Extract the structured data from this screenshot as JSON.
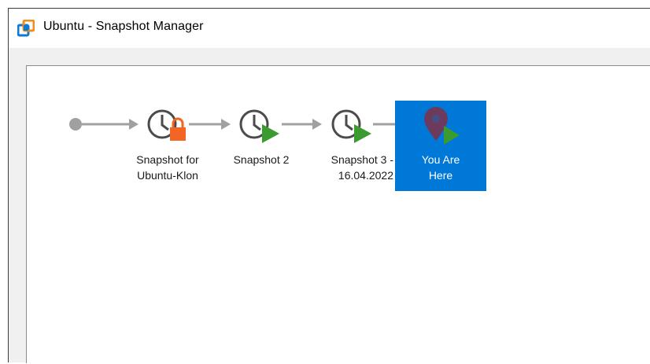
{
  "window": {
    "title": "Ubuntu - Snapshot Manager",
    "app_icon": "vmware-icon"
  },
  "snapshots": [
    {
      "label": "Snapshot for\nUbuntu-Klon",
      "icon": "clock-icon",
      "badge": "lock-badge",
      "badge_color": "#f26522"
    },
    {
      "label": "Snapshot 2",
      "icon": "clock-icon",
      "badge": "play-badge",
      "badge_color": "#3c9b2e"
    },
    {
      "label": "Snapshot 3 -\n16.04.2022",
      "icon": "clock-icon",
      "badge": "play-badge",
      "badge_color": "#3c9b2e"
    }
  ],
  "current_state": {
    "label": "You Are\nHere",
    "icon": "map-pin-icon",
    "badge": "play-badge",
    "selected": true,
    "selection_color": "#0078d7"
  },
  "colors": {
    "connector": "#a0a0a0",
    "clock_stroke": "#4b4b4b",
    "pin": "#6b3a5c"
  }
}
